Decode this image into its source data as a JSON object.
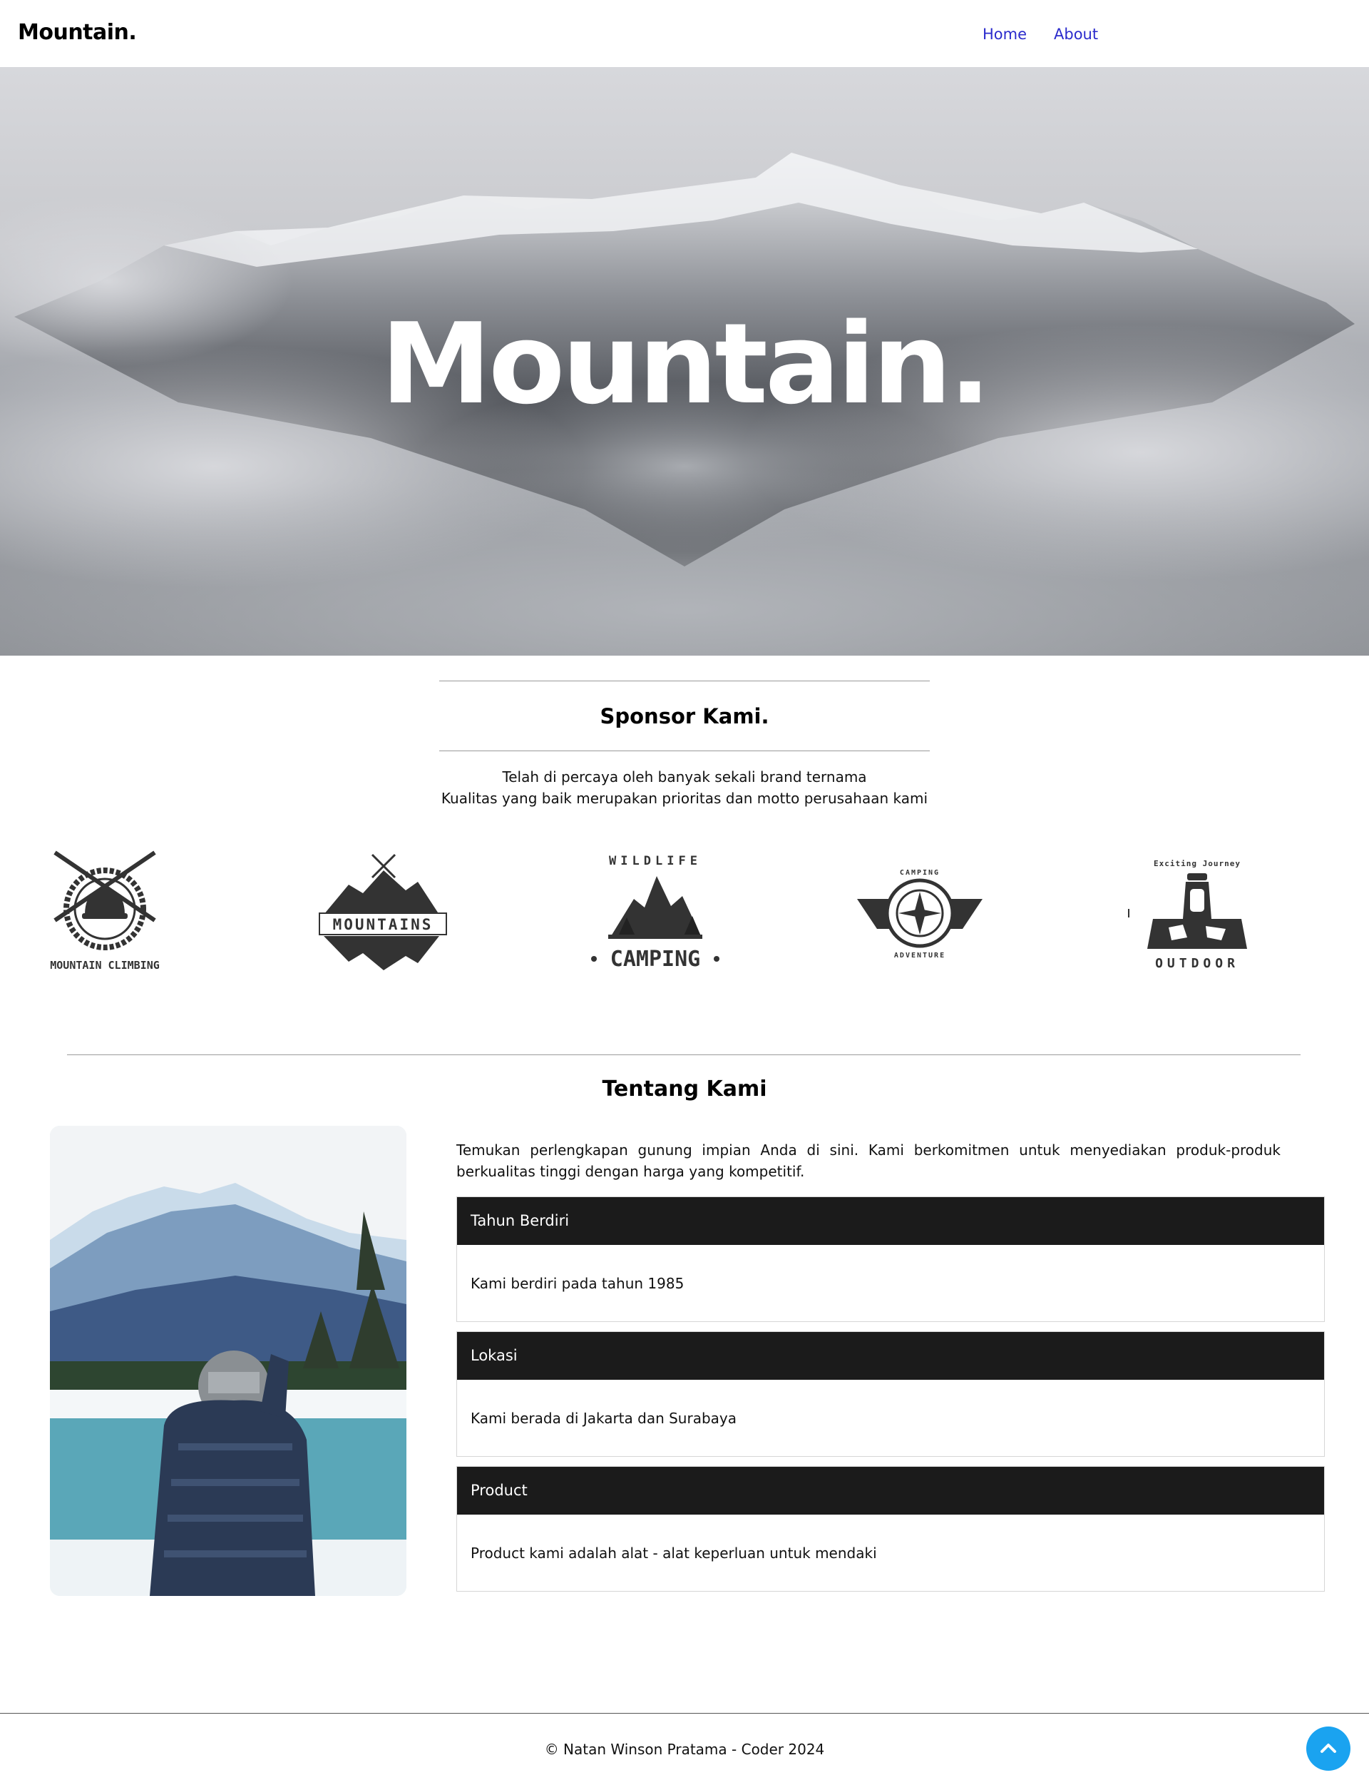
{
  "nav": {
    "brand": "Mountain.",
    "links": [
      "Home",
      "About"
    ]
  },
  "hero": {
    "title": "Mountain."
  },
  "sponsor": {
    "title": "Sponsor Kami.",
    "line1": "Telah di percaya oleh banyak sekali brand ternama",
    "line2": "Kualitas yang baik merupakan prioritas dan motto perusahaan kami",
    "logos": [
      {
        "name": "mountain-climbing-logo",
        "caption": "MOUNTAIN CLIMBING"
      },
      {
        "name": "mountains-logo",
        "caption": "MOUNTAINS"
      },
      {
        "name": "wildlife-camping-logo",
        "caption": "WILDLIFE",
        "caption2": "CAMPING"
      },
      {
        "name": "camping-adventure-logo",
        "caption": "CAMPING",
        "caption2": "ADVENTURE"
      },
      {
        "name": "outdoor-logo",
        "caption": "Exciting Journey",
        "caption2": "OUTDOOR"
      }
    ]
  },
  "about": {
    "title": "Tentang Kami",
    "intro": "Temukan perlengkapan gunung impian Anda di sini. Kami berkomitmen untuk menyediakan produk-produk berkualitas tinggi dengan harga yang kompetitif.",
    "cards": [
      {
        "title": "Tahun Berdiri",
        "body": "Kami berdiri pada tahun 1985"
      },
      {
        "title": "Lokasi",
        "body": "Kami berada di Jakarta dan Surabaya"
      },
      {
        "title": "Product",
        "body": "Product kami adalah alat - alat keperluan untuk mendaki"
      }
    ]
  },
  "footer": {
    "text": "© Natan Winson Pratama - Coder 2024"
  },
  "colors": {
    "nav_link": "#2b2bcc",
    "card_header": "#1b1b1b",
    "to_top_button": "#1aa3f0"
  },
  "icons": {
    "to_top": "chevron-up-icon"
  }
}
